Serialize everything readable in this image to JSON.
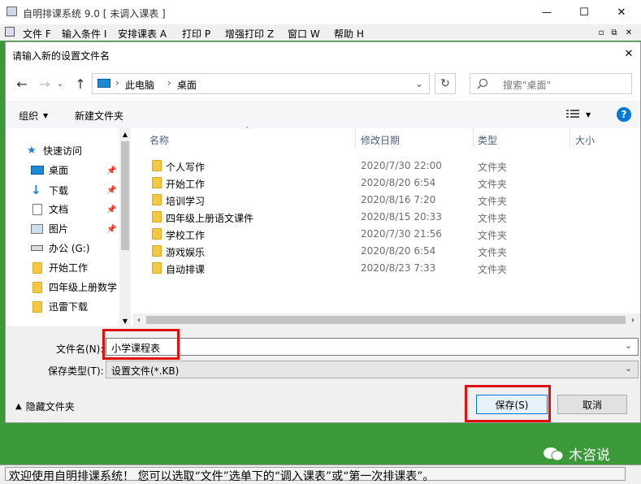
{
  "app": {
    "title": "自明排课系统 9.0 [ 未调入课表 ]",
    "menu": [
      "文件 F",
      "输入条件 I",
      "安排课表 A",
      "打印 P",
      "增强打印 Z",
      "窗口 W",
      "帮助 H"
    ],
    "status_text": "欢迎使用自明排课系统！ 您可以选取“文件”选单下的“调入课表”或“第一次排课表”。",
    "watermark": "木咨说",
    "window_controls": {
      "minimize": "—",
      "maximize": "☐",
      "close": "✕"
    },
    "mdi_controls": {
      "minimize": "▫",
      "restore": "⧉",
      "close": "✕"
    }
  },
  "dialog": {
    "title": "请输入新的设置文件名",
    "close": "✕",
    "nav": {
      "back": "←",
      "forward": "→",
      "up": "↑",
      "refresh": "↻",
      "dropdown": "⌄"
    },
    "breadcrumb": [
      "此电脑",
      "桌面"
    ],
    "breadcrumb_sep": "›",
    "search_placeholder": "搜索\"桌面\"",
    "toolbar": {
      "organize": "组织",
      "new_folder": "新建文件夹",
      "help": "?"
    },
    "sidebar": {
      "items": [
        {
          "label": "快速访问",
          "icon": "star-icon"
        },
        {
          "label": "桌面",
          "icon": "desktop-icon"
        },
        {
          "label": "下载",
          "icon": "download-icon"
        },
        {
          "label": "文档",
          "icon": "document-icon"
        },
        {
          "label": "图片",
          "icon": "picture-icon"
        },
        {
          "label": "办公 (G:)",
          "icon": "drive-icon"
        },
        {
          "label": "开始工作",
          "icon": "folder-icon"
        },
        {
          "label": "四年级上册数学",
          "icon": "folder-icon"
        },
        {
          "label": "迅雷下载",
          "icon": "folder-icon"
        }
      ]
    },
    "columns": {
      "name": "名称",
      "date": "修改日期",
      "type": "类型",
      "size": "大小"
    },
    "files": [
      {
        "name": "个人写作",
        "date": "2020/7/30 22:00",
        "type": "文件夹"
      },
      {
        "name": "开始工作",
        "date": "2020/8/20 6:54",
        "type": "文件夹"
      },
      {
        "name": "培训学习",
        "date": "2020/8/16 7:20",
        "type": "文件夹"
      },
      {
        "name": "四年级上册语文课件",
        "date": "2020/8/15 20:33",
        "type": "文件夹"
      },
      {
        "name": "学校工作",
        "date": "2020/7/30 21:56",
        "type": "文件夹"
      },
      {
        "name": "游戏娱乐",
        "date": "2020/8/20 6:54",
        "type": "文件夹"
      },
      {
        "name": "自动排课",
        "date": "2020/8/23 7:33",
        "type": "文件夹"
      }
    ],
    "filename_label": "文件名(N):",
    "filename_value": "小学课程表",
    "filetype_label": "保存类型(T):",
    "filetype_value": "设置文件(*.KB)",
    "hide_folders": "隐藏文件夹",
    "save": "保存(S)",
    "cancel": "取消"
  },
  "colors": {
    "app_bg": "#3a9a3a",
    "highlight": "#e01010",
    "accent": "#0078d7"
  }
}
